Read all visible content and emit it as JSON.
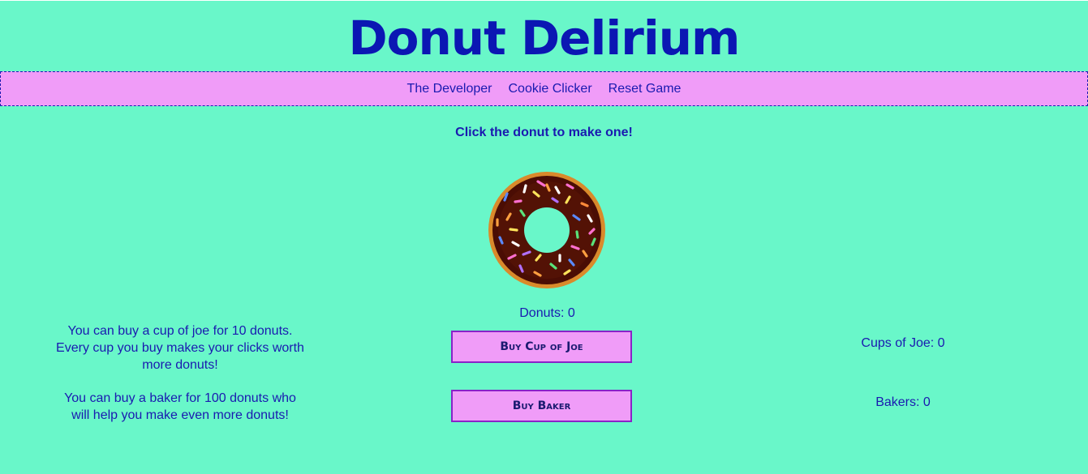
{
  "header": {
    "title": "Donut Delirium"
  },
  "nav": {
    "items": [
      {
        "label": "The Developer"
      },
      {
        "label": "Cookie Clicker"
      },
      {
        "label": "Reset Game"
      }
    ]
  },
  "main": {
    "instruction": "Click the donut to make one!",
    "donut_count": "Donuts: 0",
    "cup_of_joe": {
      "description_line1": "You can buy a cup of joe for 10 donuts.",
      "description_line2": "Every cup you buy makes your clicks worth",
      "description_line3": "more donuts!",
      "button_label": "Buy Cup of Joe",
      "count": "Cups of Joe: 0"
    },
    "baker": {
      "description_line1": "You can buy a baker for 100 donuts who",
      "description_line2": "will help you make even more donuts!",
      "button_label": "Buy Baker",
      "count": "Bakers: 0"
    }
  },
  "colors": {
    "background": "#69f7c9",
    "nav_background": "#f09cf8",
    "text": "#1a1ab0",
    "button_border": "#8a22c8"
  }
}
